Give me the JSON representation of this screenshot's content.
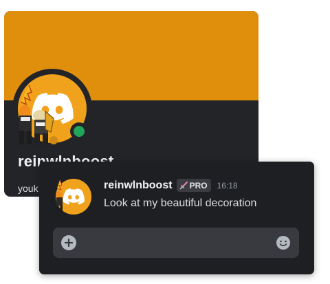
{
  "profile": {
    "username": "reinwlnboost",
    "subtitle": "youk",
    "status": "online",
    "colors": {
      "banner": "#e08f0c",
      "avatar_bg": "#f1a21d",
      "card_bg": "#232428",
      "status_online": "#23a55a"
    },
    "avatar_icon": "discord-logo-icon",
    "decoration": "hero-figures-avatar-decoration"
  },
  "message": {
    "username": "reinwlnboost",
    "badge": "PRO",
    "badge_icon": "sword-icon",
    "time": "16:18",
    "text": "Look at my beautiful decoration"
  },
  "composer": {
    "add_icon": "plus-circle-icon",
    "emoji_icon": "smiley-face-icon",
    "bg": "#383a40"
  }
}
